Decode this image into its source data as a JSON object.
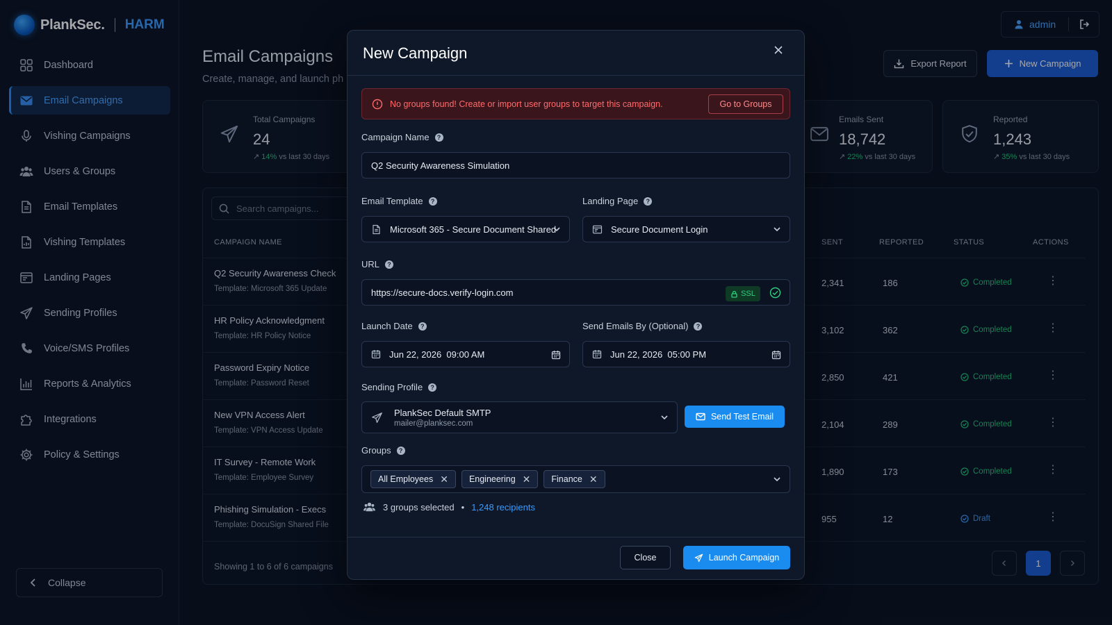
{
  "brand": {
    "name": "PlankSec.",
    "product": "HARM"
  },
  "sidebar": {
    "items": [
      {
        "label": "Dashboard",
        "icon": "dashboard-icon"
      },
      {
        "label": "Email Campaigns",
        "icon": "mail-icon",
        "active": true
      },
      {
        "label": "Vishing Campaigns",
        "icon": "microphone-icon"
      },
      {
        "label": "Users & Groups",
        "icon": "users-icon"
      },
      {
        "label": "Email Templates",
        "icon": "document-icon"
      },
      {
        "label": "Vishing Templates",
        "icon": "audio-document-icon"
      },
      {
        "label": "Landing Pages",
        "icon": "browser-window-icon"
      },
      {
        "label": "Sending Profiles",
        "icon": "paper-plane-icon"
      },
      {
        "label": "Voice/SMS Profiles",
        "icon": "phone-icon"
      },
      {
        "label": "Reports & Analytics",
        "icon": "bar-chart-icon"
      },
      {
        "label": "Integrations",
        "icon": "puzzle-icon"
      },
      {
        "label": "Policy & Settings",
        "icon": "gear-icon"
      }
    ],
    "collapse_label": "Collapse"
  },
  "header": {
    "title": "Email Campaigns",
    "subtitle": "Create, manage, and launch ph",
    "user": "admin",
    "export_label": "Export Report",
    "new_campaign_label": "New Campaign"
  },
  "stats": [
    {
      "label": "Total Campaigns",
      "value": "24",
      "trend": "14%",
      "trend_suffix": "vs last 30 days"
    },
    {
      "label": "Emails Sent",
      "value": "18,742",
      "trend": "22%",
      "trend_suffix": "vs last 30 days"
    },
    {
      "label": "Reported",
      "value": "1,243",
      "trend": "35%",
      "trend_suffix": "vs last 30 days"
    }
  ],
  "table": {
    "search_placeholder": "Search campaigns...",
    "columns": {
      "name": "CAMPAIGN NAME",
      "sent": "SENT",
      "reported": "REPORTED",
      "status": "STATUS",
      "actions": "ACTIONS"
    },
    "rows": [
      {
        "name": "Q2 Security Awareness Check",
        "template": "Template: Microsoft 365 Update",
        "sent": "2,341",
        "reported": "186",
        "status": "Completed"
      },
      {
        "name": "HR Policy Acknowledgment",
        "template": "Template: HR Policy Notice",
        "sent": "3,102",
        "reported": "362",
        "status": "Completed"
      },
      {
        "name": "Password Expiry Notice",
        "template": "Template: Password Reset",
        "sent": "2,850",
        "reported": "421",
        "status": "Completed"
      },
      {
        "name": "New VPN Access Alert",
        "template": "Template: VPN Access Update",
        "sent": "2,104",
        "reported": "289",
        "status": "Completed"
      },
      {
        "name": "IT Survey - Remote Work",
        "template": "Template: Employee Survey",
        "sent": "1,890",
        "reported": "173",
        "status": "Completed"
      },
      {
        "name": "Phishing Simulation - Execs",
        "template": "Template: DocuSign Shared File",
        "sent": "955",
        "reported": "12",
        "status": "Draft"
      }
    ],
    "footer": "Showing 1 to 6 of 6 campaigns",
    "current_page": "1"
  },
  "modal": {
    "title": "New Campaign",
    "alert": {
      "text": "No groups found! Create or import user groups to target this campaign.",
      "button": "Go to Groups"
    },
    "campaign_name": {
      "label": "Campaign Name",
      "value": "Q2 Security Awareness Simulation"
    },
    "email_template": {
      "label": "Email Template",
      "value": "Microsoft 365 - Secure Document Shared"
    },
    "landing_page": {
      "label": "Landing Page",
      "value": "Secure Document Login"
    },
    "url": {
      "label": "URL",
      "value": "https://secure-docs.verify-login.com",
      "ssl": "SSL"
    },
    "launch_date": {
      "label": "Launch Date",
      "value": "Jun 22, 2026  09:00 AM"
    },
    "send_by": {
      "label": "Send Emails By (Optional)",
      "value": "Jun 22, 2026  05:00 PM"
    },
    "sending_profile": {
      "label": "Sending Profile",
      "name": "PlankSec Default SMTP",
      "email": "mailer@planksec.com",
      "test_button": "Send Test Email"
    },
    "groups": {
      "label": "Groups",
      "chips": [
        "All Employees",
        "Engineering",
        "Finance"
      ],
      "summary": "3 groups selected",
      "separator": "•",
      "recipients": "1,248 recipients"
    },
    "close_label": "Close",
    "launch_label": "Launch Campaign"
  },
  "colors": {
    "accent": "#2a8cff",
    "primary_button": "#1d5bd1",
    "success": "#22c37a",
    "danger": "#ff6b6b",
    "background": "#0a1120"
  }
}
